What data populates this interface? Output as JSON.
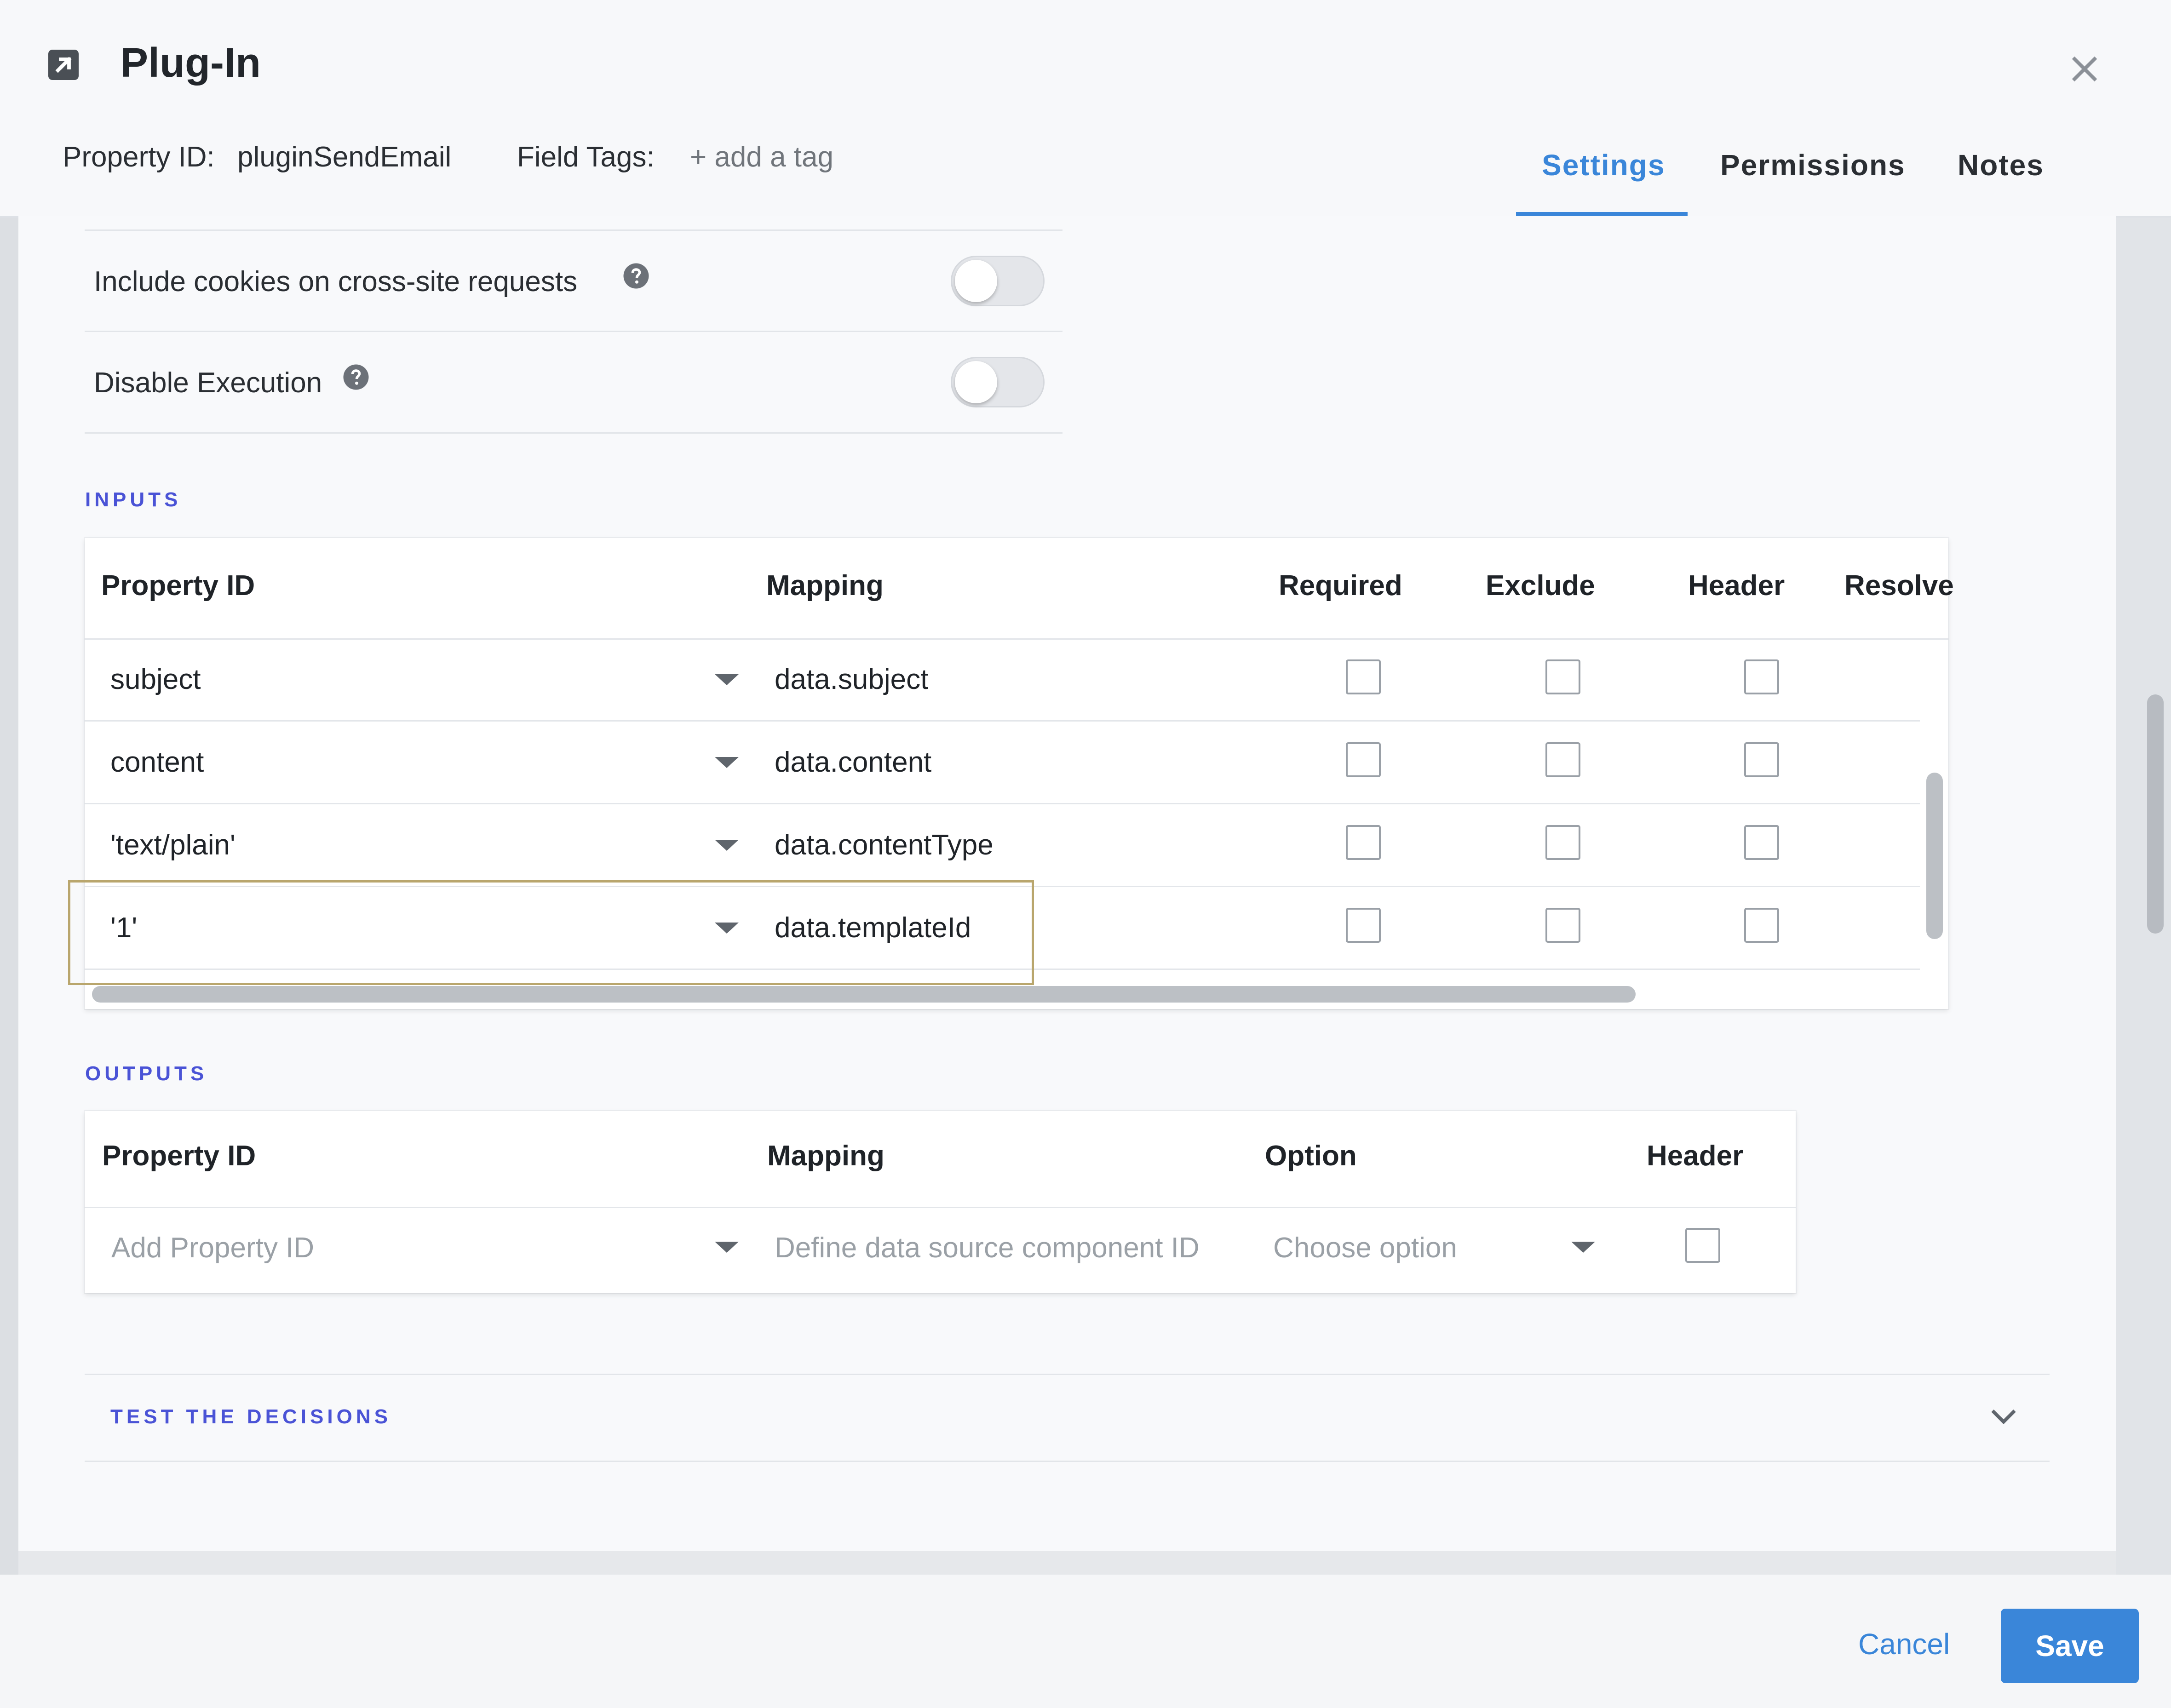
{
  "dialog": {
    "title": "Plug-In",
    "property_id_label": "Property ID:",
    "property_id_value": "pluginSendEmail",
    "field_tags_label": "Field Tags:",
    "add_tag": "+ add a tag",
    "tabs": [
      {
        "label": "Settings",
        "active": true
      },
      {
        "label": "Permissions",
        "active": false
      },
      {
        "label": "Notes",
        "active": false
      }
    ]
  },
  "toggles": [
    {
      "label": "Include cookies on cross-site requests",
      "on": false
    },
    {
      "label": "Disable Execution",
      "on": false
    }
  ],
  "inputs": {
    "section_title": "INPUTS",
    "headers": {
      "property_id": "Property ID",
      "mapping": "Mapping",
      "required": "Required",
      "exclude": "Exclude",
      "header": "Header",
      "resolve": "Resolve"
    },
    "rows": [
      {
        "property_id": "subject",
        "mapping": "data.subject",
        "required": false,
        "exclude": false,
        "header": false
      },
      {
        "property_id": "content",
        "mapping": "data.content",
        "required": false,
        "exclude": false,
        "header": false
      },
      {
        "property_id": "'text/plain'",
        "mapping": "data.contentType",
        "required": false,
        "exclude": false,
        "header": false
      },
      {
        "property_id": "'1'",
        "mapping": "data.templateId",
        "required": false,
        "exclude": false,
        "header": false
      }
    ]
  },
  "outputs": {
    "section_title": "OUTPUTS",
    "headers": {
      "property_id": "Property ID",
      "mapping": "Mapping",
      "option": "Option",
      "header": "Header"
    },
    "row": {
      "property_id_placeholder": "Add Property ID",
      "mapping_placeholder": "Define data source component ID",
      "option_placeholder": "Choose option",
      "header": false
    }
  },
  "accordion": {
    "label": "TEST THE DECISIONS"
  },
  "footer": {
    "cancel": "Cancel",
    "save": "Save"
  },
  "colors": {
    "accent": "#3a86d9",
    "section_title": "#4a53d6",
    "highlight_border": "#b9a66d"
  }
}
